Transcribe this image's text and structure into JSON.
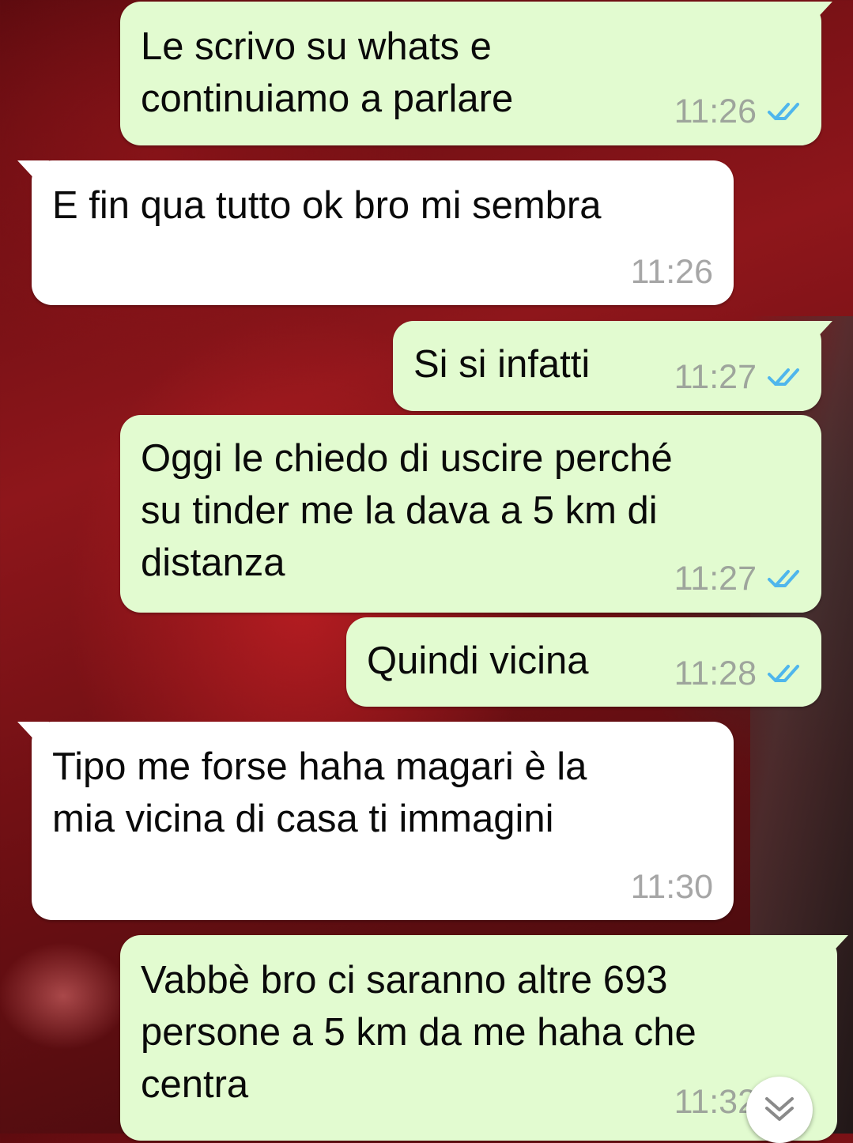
{
  "messages": [
    {
      "direction": "outgoing",
      "text": "Le scrivo su whats e\ncontinuiamo a parlare",
      "time": "11:26",
      "status": "read"
    },
    {
      "direction": "incoming",
      "text": "E fin qua tutto ok bro mi sembra",
      "time": "11:26"
    },
    {
      "direction": "outgoing",
      "text": "Si si infatti",
      "time": "11:27",
      "status": "read"
    },
    {
      "direction": "outgoing",
      "text": "Oggi le chiedo di uscire perché\nsu tinder me la dava a 5 km di\ndistanza",
      "time": "11:27",
      "status": "read"
    },
    {
      "direction": "outgoing",
      "text": "Quindi vicina",
      "time": "11:28",
      "status": "read"
    },
    {
      "direction": "incoming",
      "text": "Tipo me forse haha magari è la\nmia vicina di casa ti immagini",
      "time": "11:30"
    },
    {
      "direction": "outgoing",
      "text": "Vabbè bro ci saranno altre 693\npersone a 5 km da me haha che\ncentra",
      "time": "11:32",
      "status": "read"
    }
  ],
  "icons": {
    "read_tick": "double-check-icon",
    "scroll_down": "chevron-down-icon"
  },
  "colors": {
    "outgoing_bubble": "#e2fbd0",
    "incoming_bubble": "#ffffff",
    "read_tick": "#4fb6ec",
    "timestamp": "#9ea59c"
  }
}
